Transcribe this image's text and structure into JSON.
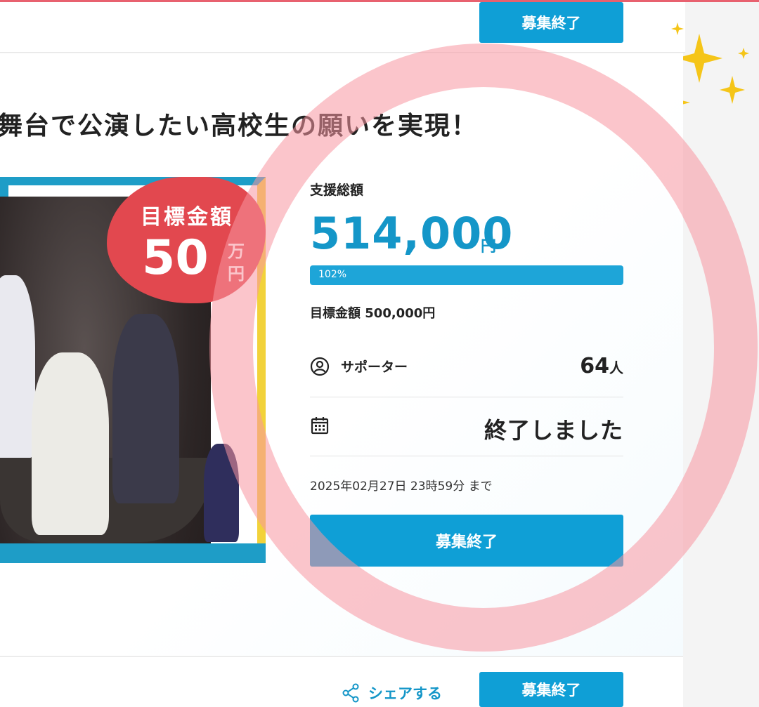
{
  "header": {
    "button_label": "募集終了"
  },
  "project": {
    "title": "舞台で公演したい高校生の願いを実現！"
  },
  "visual": {
    "badge_title": "目標金額",
    "badge_amount": "50",
    "badge_unit_top": "万",
    "badge_unit_bottom": "円"
  },
  "stats": {
    "total_label": "支援総額",
    "total_amount": "514,000",
    "total_unit": "円",
    "progress_percent": 102,
    "progress_text": "102%",
    "goal_text": "目標金額 500,000円",
    "supporters_label": "サポーター",
    "supporters_value": "64",
    "supporters_unit": "人",
    "status_text": "終了しました",
    "deadline_text": "2025年02月27日 23時59分 まで",
    "action_label": "募集終了"
  },
  "footer": {
    "share_label": "シェアする",
    "button_label": "募集終了"
  },
  "colors": {
    "accent": "#0f9fd6",
    "badge": "#e2484f",
    "ring": "#f896a0",
    "sparkle": "#f5c518"
  }
}
